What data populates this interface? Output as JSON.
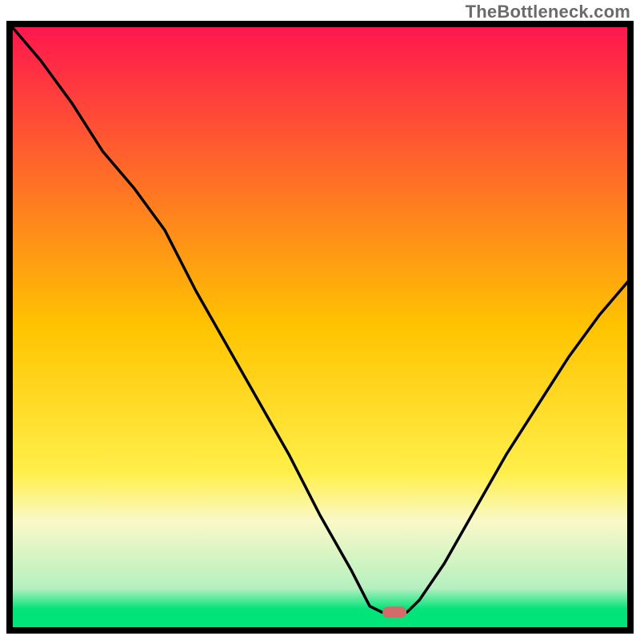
{
  "attribution": "TheBottleneck.com",
  "chart_data": {
    "type": "line",
    "title": "",
    "xlabel": "",
    "ylabel": "",
    "xlim": [
      0,
      100
    ],
    "ylim": [
      0,
      100
    ],
    "background_gradient": [
      {
        "pos": 0.0,
        "color": "#ff154f"
      },
      {
        "pos": 0.5,
        "color": "#ffc400"
      },
      {
        "pos": 0.74,
        "color": "#ffef4a"
      },
      {
        "pos": 0.82,
        "color": "#faf9c8"
      },
      {
        "pos": 0.93,
        "color": "#b6f0c0"
      },
      {
        "pos": 0.965,
        "color": "#00e47a"
      },
      {
        "pos": 1.0,
        "color": "#00e47a"
      }
    ],
    "marker": {
      "x": 62,
      "y": 97,
      "color": "#d46a6a"
    },
    "series": [
      {
        "name": "curve",
        "x": [
          0,
          5,
          10,
          15,
          20,
          25,
          30,
          35,
          40,
          45,
          50,
          55,
          58,
          60,
          64,
          66,
          70,
          75,
          80,
          85,
          90,
          95,
          100
        ],
        "y": [
          100,
          94,
          87,
          79,
          73,
          66,
          56,
          47,
          38,
          29,
          19,
          10,
          4,
          3,
          3,
          5,
          11,
          20,
          29,
          37,
          45,
          52,
          58
        ]
      }
    ]
  }
}
